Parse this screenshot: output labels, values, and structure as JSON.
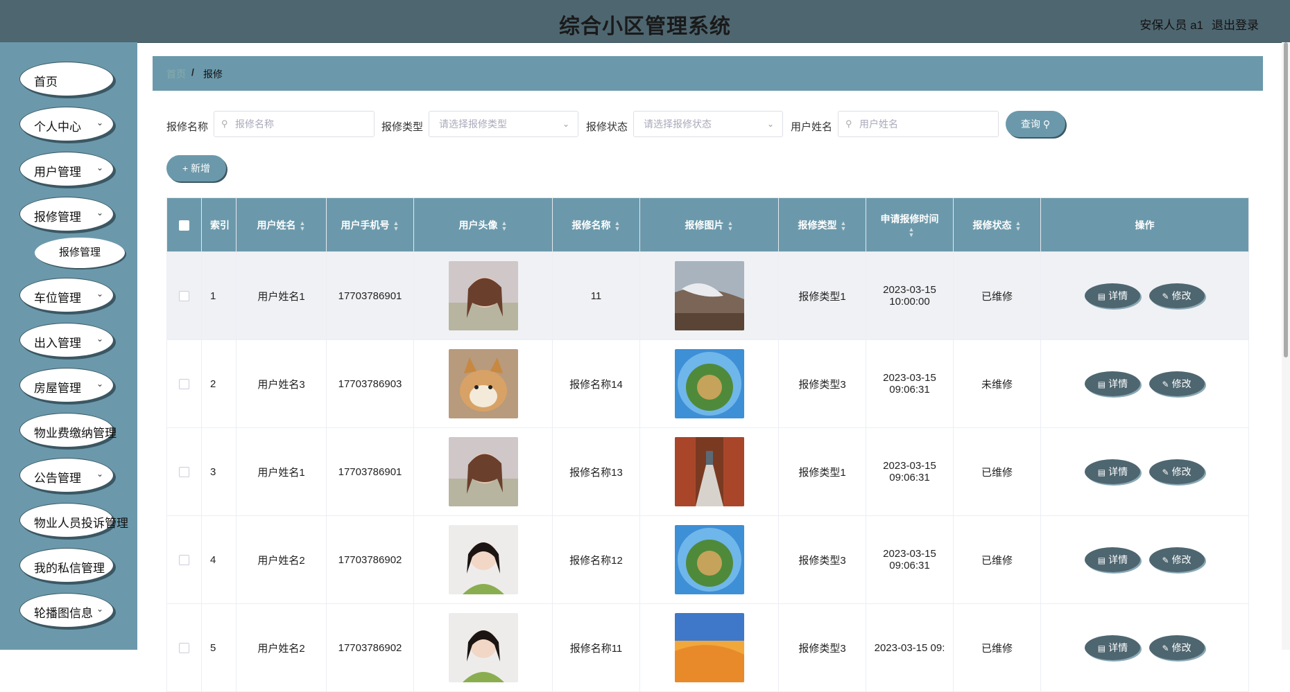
{
  "header": {
    "title": "综合小区管理系统",
    "user": "安保人员 a1",
    "logout": "退出登录"
  },
  "sidebar": {
    "items": [
      {
        "label": "首页"
      },
      {
        "label": "个人中心"
      },
      {
        "label": "用户管理"
      },
      {
        "label": "报修管理"
      },
      {
        "label": "报修管理"
      },
      {
        "label": "车位管理"
      },
      {
        "label": "出入管理"
      },
      {
        "label": "房屋管理"
      },
      {
        "label": "物业费缴纳管理"
      },
      {
        "label": "公告管理"
      },
      {
        "label": "物业人员投诉管理"
      },
      {
        "label": "我的私信管理"
      },
      {
        "label": "轮播图信息"
      }
    ]
  },
  "breadcrumb": {
    "home": "首页",
    "separator": "/",
    "current": "报修"
  },
  "search": {
    "name_label": "报修名称",
    "name_placeholder": "报修名称",
    "type_label": "报修类型",
    "type_placeholder": "请选择报修类型",
    "status_label": "报修状态",
    "status_placeholder": "请选择报修状态",
    "user_label": "用户姓名",
    "user_placeholder": "用户姓名",
    "query_button": "查询",
    "add_button": "新增"
  },
  "table": {
    "columns": [
      "索引",
      "用户姓名",
      "用户手机号",
      "用户头像",
      "报修名称",
      "报修图片",
      "报修类型",
      "申请报修时间",
      "报修状态",
      "操作"
    ],
    "detail_label": "详情",
    "edit_label": "修改",
    "rows": [
      {
        "index": "1",
        "user": "用户姓名1",
        "phone": "17703786901",
        "name": "11",
        "type": "报修类型1",
        "time": "2023-03-15 10:00:00",
        "status": "已维修"
      },
      {
        "index": "2",
        "user": "用户姓名3",
        "phone": "17703786903",
        "name": "报修名称14",
        "type": "报修类型3",
        "time": "2023-03-15 09:06:31",
        "status": "未维修"
      },
      {
        "index": "3",
        "user": "用户姓名1",
        "phone": "17703786901",
        "name": "报修名称13",
        "type": "报修类型1",
        "time": "2023-03-15 09:06:31",
        "status": "已维修"
      },
      {
        "index": "4",
        "user": "用户姓名2",
        "phone": "17703786902",
        "name": "报修名称12",
        "type": "报修类型3",
        "time": "2023-03-15 09:06:31",
        "status": "已维修"
      },
      {
        "index": "5",
        "user": "用户姓名2",
        "phone": "17703786902",
        "name": "报修名称11",
        "type": "报修类型3",
        "time": "2023-03-15 09:",
        "status": "已维修"
      }
    ]
  },
  "colors": {
    "header_bg": "#4e6670",
    "sidebar_bg": "#6b99ab",
    "accent": "#6b99ab",
    "button_dark": "#4e6670"
  }
}
